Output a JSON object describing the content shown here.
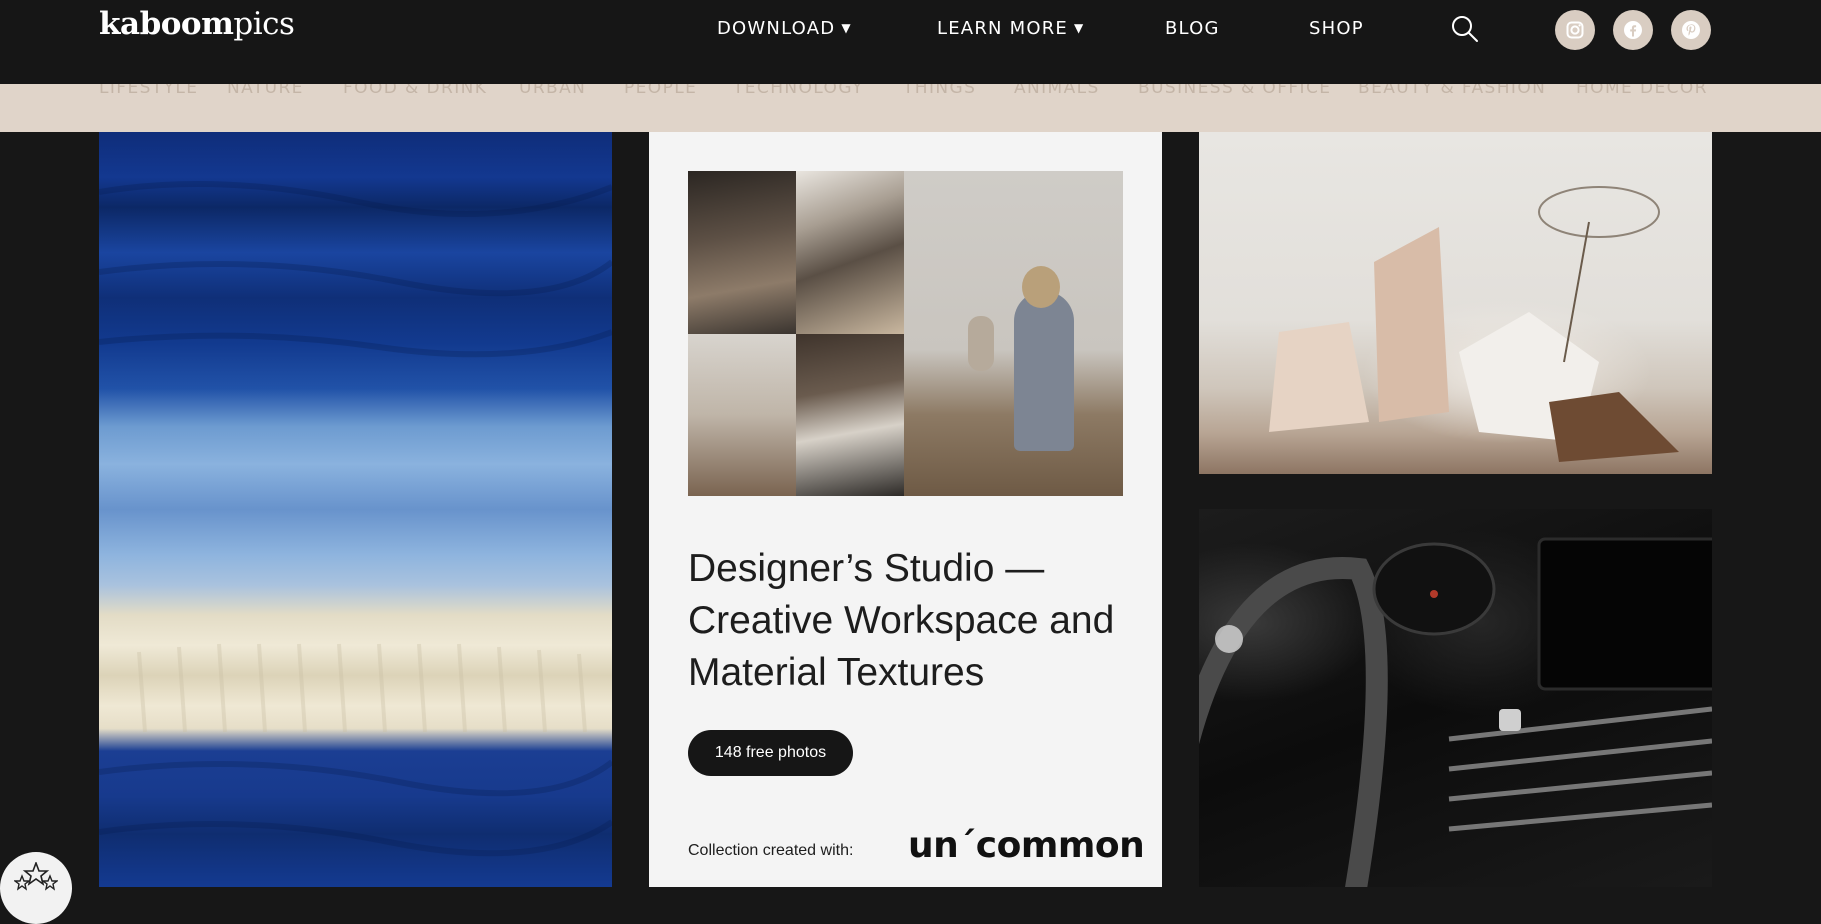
{
  "header": {
    "logo_bold": "kaboom",
    "logo_light": "pics",
    "nav": [
      {
        "label": "DOWNLOAD",
        "has_chevron": true
      },
      {
        "label": "LEARN MORE",
        "has_chevron": true
      },
      {
        "label": "BLOG",
        "has_chevron": false
      },
      {
        "label": "SHOP",
        "has_chevron": false
      }
    ],
    "icons": {
      "search": "search-icon",
      "social": [
        "instagram-icon",
        "facebook-icon",
        "pinterest-icon"
      ]
    }
  },
  "categories": [
    "LIFESTYLE",
    "NATURE",
    "FOOD & DRINK",
    "URBAN",
    "PEOPLE",
    "TECHNOLOGY",
    "THINGS",
    "ANIMALS",
    "BUSINESS & OFFICE",
    "BEAUTY & FASHION",
    "HOME DECOR"
  ],
  "featured": {
    "title": "Designer’s Studio — Creative Workspace and Material Textures",
    "photo_count_label": "148 free photos",
    "credit_label": "Collection created with:",
    "brand_logo": "un´common"
  },
  "colors": {
    "header_bg": "#161616",
    "category_bar_bg": "#e0d4c9",
    "category_text": "#c4b5a7",
    "social_circle": "#d9cdc2",
    "card_bg": "#f4f4f4",
    "pill_bg": "#161616"
  }
}
